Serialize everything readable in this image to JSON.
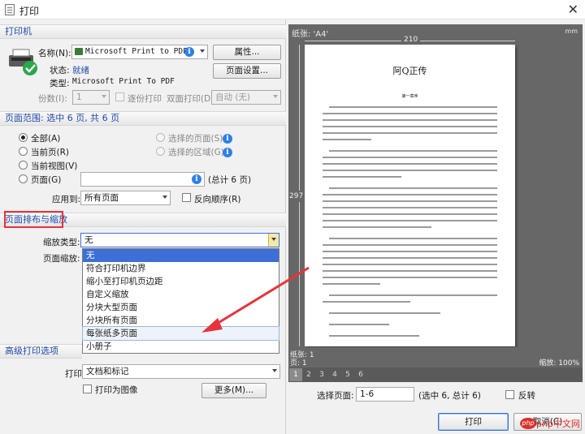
{
  "window": {
    "title": "打印",
    "close": "✕"
  },
  "printer": {
    "section": "打印机",
    "name_label": "名称(N):",
    "name_value": "Microsoft Print to PDF",
    "properties_button": "属性...",
    "status_label": "状态:",
    "status_value": "就绪",
    "type_label": "类型:",
    "type_value": "Microsoft Print To PDF",
    "page_setup_button": "页面设置...",
    "copies_label": "份数(I):",
    "copies_value": "1",
    "collate_label": "逐份打印",
    "duplex_label": "双面打印(D):",
    "duplex_value": "自动 (无)"
  },
  "range": {
    "section": "页面范围: 选中 6 页, 共 6 页",
    "all": "全部(A)",
    "current": "当前页(R)",
    "current_view": "当前视图(V)",
    "pages": "页面(G)",
    "pages_hint": "(总计 6 页)",
    "selected_pages": "选择的页面(S)",
    "selected_area": "选择的区域(G)",
    "apply_label": "应用到:",
    "apply_value": "所有页面",
    "reverse_label": "反向顺序(R)"
  },
  "layout": {
    "section": "页面排布与缩放",
    "scale_type_label": "缩放类型:",
    "scale_type_value": "无",
    "page_scale_label": "页面缩放:",
    "options": [
      "无",
      "符合打印机边界",
      "缩小至打印机页边距",
      "自定义缩放",
      "分块大型页面",
      "分块所有页面",
      "每张纸多页面",
      "小册子"
    ]
  },
  "advanced": {
    "section": "高级打印选项",
    "print_label": "打印",
    "print_value": "文档和标记",
    "as_image_label": "打印为图像",
    "more_button": "更多(M)..."
  },
  "preview": {
    "paper_label": "纸张: 'A4'",
    "unit": "mm",
    "width_dim": "210",
    "height_dim": "297",
    "doc_title": "阿Q正传",
    "doc_sub": "第一章序",
    "status_paper": "纸张: 1",
    "status_page": "页: 1",
    "zoom": "缩放: 100%",
    "page_tabs": [
      "1",
      "2",
      "3",
      "4",
      "5",
      "6"
    ],
    "select_pages_label": "选择页面:",
    "select_pages_value": "1-6",
    "select_pages_hint": "(选中 6, 总计 6)",
    "reverse_label": "反转"
  },
  "footer": {
    "print_button": "打印",
    "cancel_button": "取消(C)"
  },
  "watermark": "php中文网",
  "colors": {
    "accent": "#1e4aa8",
    "highlight": "#e6343a",
    "selected": "#3d6fd6"
  }
}
